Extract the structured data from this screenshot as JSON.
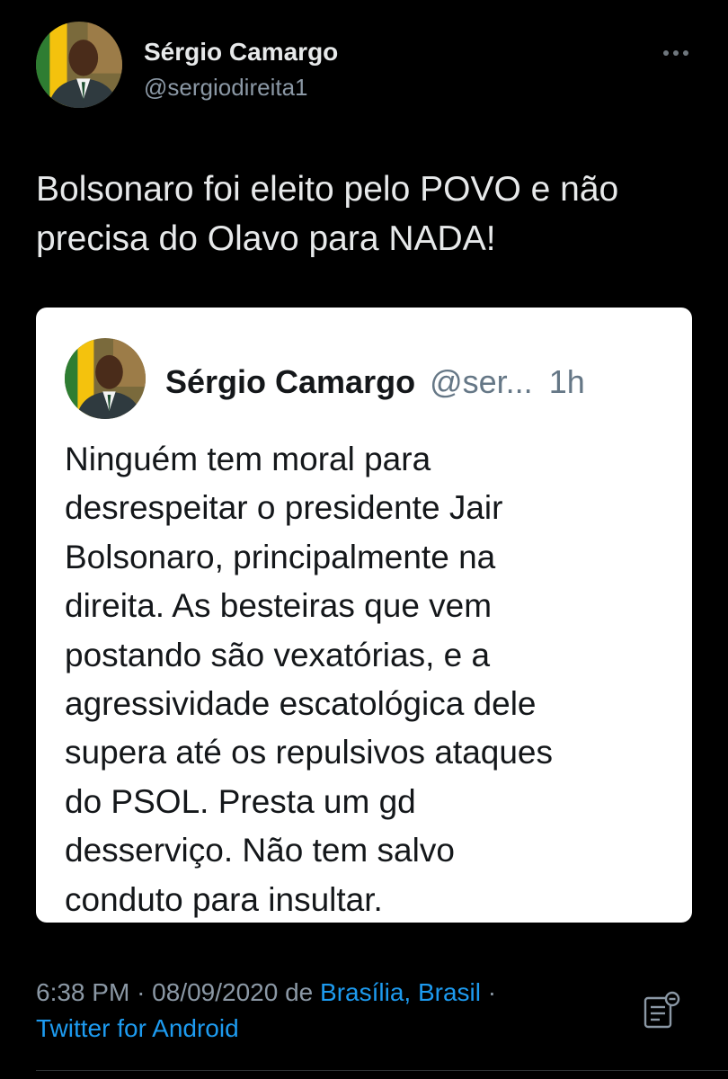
{
  "author": {
    "display_name": "Sérgio Camargo",
    "handle": "@sergiodireita1",
    "avatar_icon": "profile-photo"
  },
  "tweet": {
    "text_lines": [
      "Bolsonaro foi eleito pelo POVO e não",
      "precisa do Olavo para NADA!"
    ]
  },
  "quoted_tweet": {
    "display_name": "Sérgio Camargo",
    "handle": "@ser...",
    "time": "1h",
    "text_lines": [
      "Ninguém tem moral para",
      "desrespeitar o presidente Jair",
      "Bolsonaro, principalmente na",
      "direita. As besteiras que vem",
      "postando são vexatórias, e a",
      "agressividade escatológica dele",
      "supera até os repulsivos ataques",
      "do PSOL. Presta um gd",
      "desserviço. Não tem salvo",
      "conduto para insultar."
    ]
  },
  "meta": {
    "time": "6:38 PM",
    "separator": "·",
    "date": "08/09/2020",
    "from_word": "de",
    "location": "Brasília, Brasil",
    "source": "Twitter for Android"
  },
  "icons": {
    "more": "more-dots-icon",
    "analytics": "tweet-analytics-icon"
  },
  "colors": {
    "background": "#000000",
    "primary_text": "#e7e9ea",
    "secondary_text": "#8b98a5",
    "link": "#1d9bf0",
    "card_background": "#ffffff"
  }
}
